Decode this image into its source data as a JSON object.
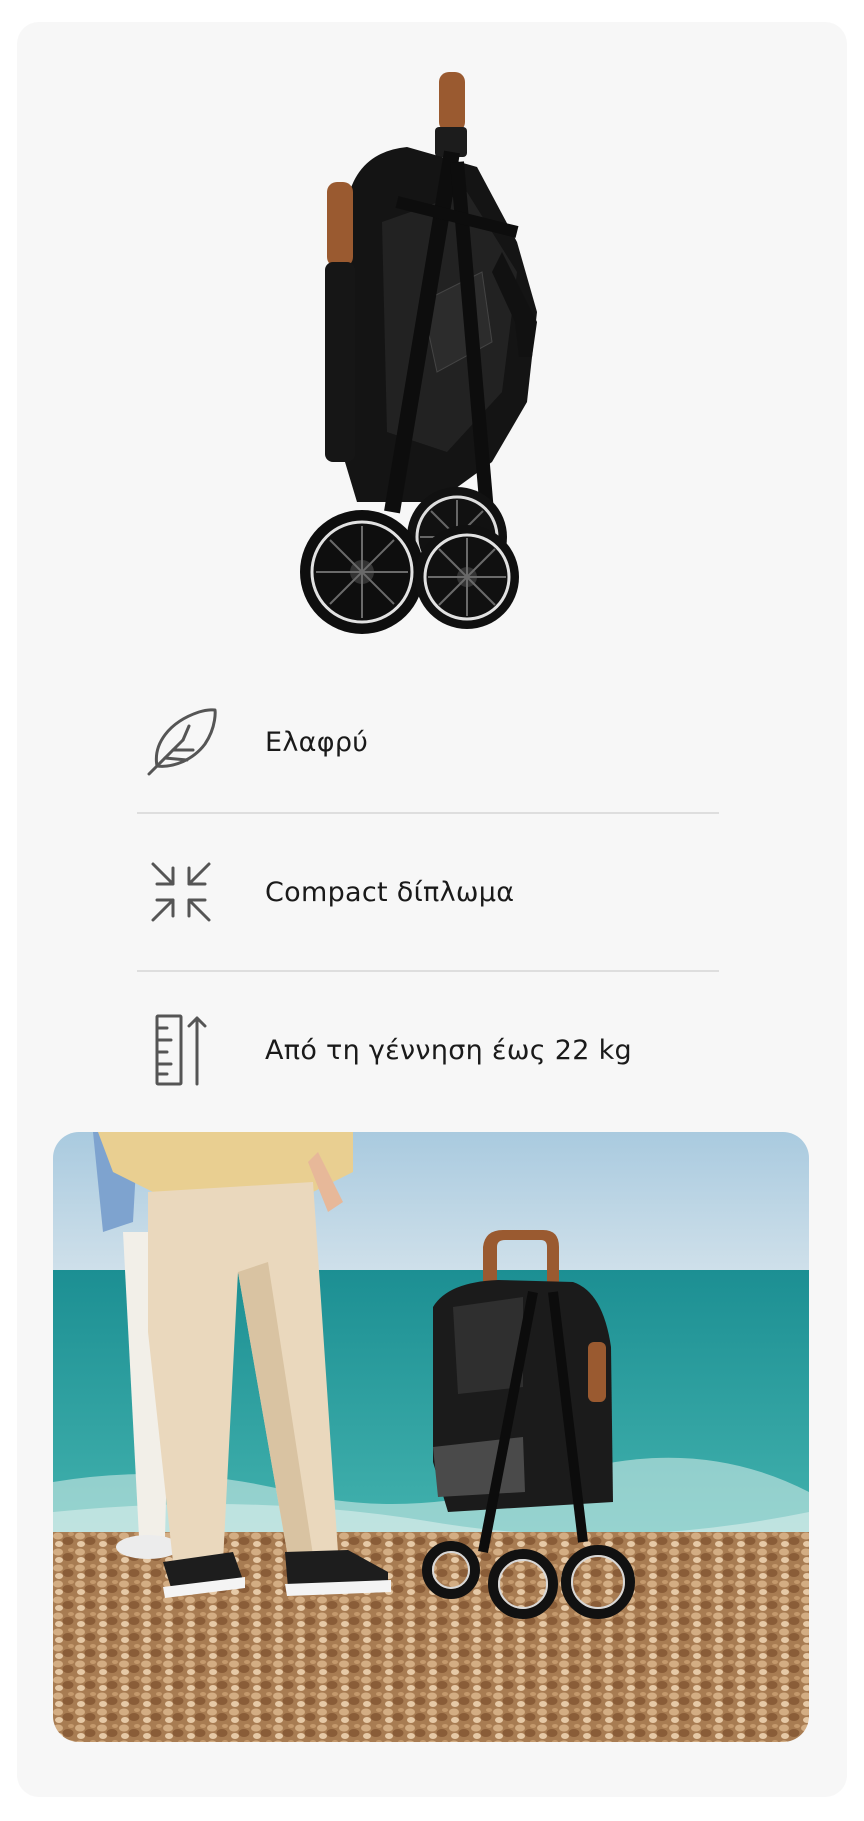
{
  "product_image": {
    "icon": "folded-stroller-image",
    "colors": {
      "frame": "#151515",
      "handle": "#9a5a30",
      "wheel_rim": "#dddddd"
    }
  },
  "features": [
    {
      "icon": "feather-icon",
      "label": "Ελαφρύ"
    },
    {
      "icon": "compress-arrows-icon",
      "label": "Compact δίπλωμα"
    },
    {
      "icon": "ruler-height-icon",
      "label": "Από τη γέννηση έως 22 kg"
    }
  ],
  "lifestyle_photo": {
    "icon": "beach-stroller-photo",
    "colors": {
      "sky": "#bcd6e6",
      "sea": "#2fa6a4",
      "pebbles": "#b8895c",
      "trousers": "#ead8bd"
    }
  }
}
